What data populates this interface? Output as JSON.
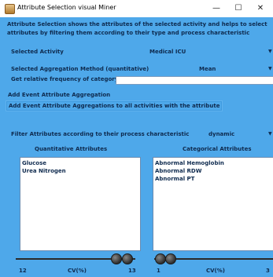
{
  "window": {
    "title": "Attribute Selection visual Miner",
    "minimize_glyph": "—",
    "maximize_glyph": "☐",
    "close_glyph": "✕"
  },
  "description": "Attribute Selection shows the attributes of the selected activity and helps to select attributes by filtering them according to their type and process characteristic",
  "selected_activity": {
    "label": "Selected Activity",
    "value": "Medical ICU"
  },
  "aggregation": {
    "label": "Selected Aggregation Method (quantitative)",
    "value": "Mean"
  },
  "relative_frequency": {
    "label": "Get relative frequency of category",
    "value": ""
  },
  "buttons": {
    "add_aggregation": "Add Event Attribute Aggregation",
    "add_aggregations_all": "Add Event Attribute Aggregations to all activities with the attribute"
  },
  "filter": {
    "label": "Filter Attributes according to their process characteristic",
    "value": "dynamic"
  },
  "quantitative": {
    "title": "Quantitative Attributes",
    "items": [
      "Glucose",
      "Urea Nitrogen"
    ],
    "slider": {
      "min_label": "12",
      "axis_label": "CV(%)",
      "max_label": "13",
      "low": 0.9,
      "high": 1.0
    }
  },
  "categorical": {
    "title": "Categorical Attributes",
    "items": [
      "Abnormal Hemoglobin",
      "Abnormal RDW",
      "Abnormal PT"
    ],
    "slider": {
      "min_label": "1",
      "axis_label": "CV(%)",
      "max_label": "3",
      "low": 0.0,
      "high": 0.1
    }
  },
  "colors": {
    "panel_bg": "#4ea8ea",
    "text": "#0e2a4e",
    "list_bg": "#ffffff"
  },
  "icons": {
    "app": "app-icon",
    "dropdown": "chevron-down-icon",
    "slider_knob": "slider-knob"
  }
}
